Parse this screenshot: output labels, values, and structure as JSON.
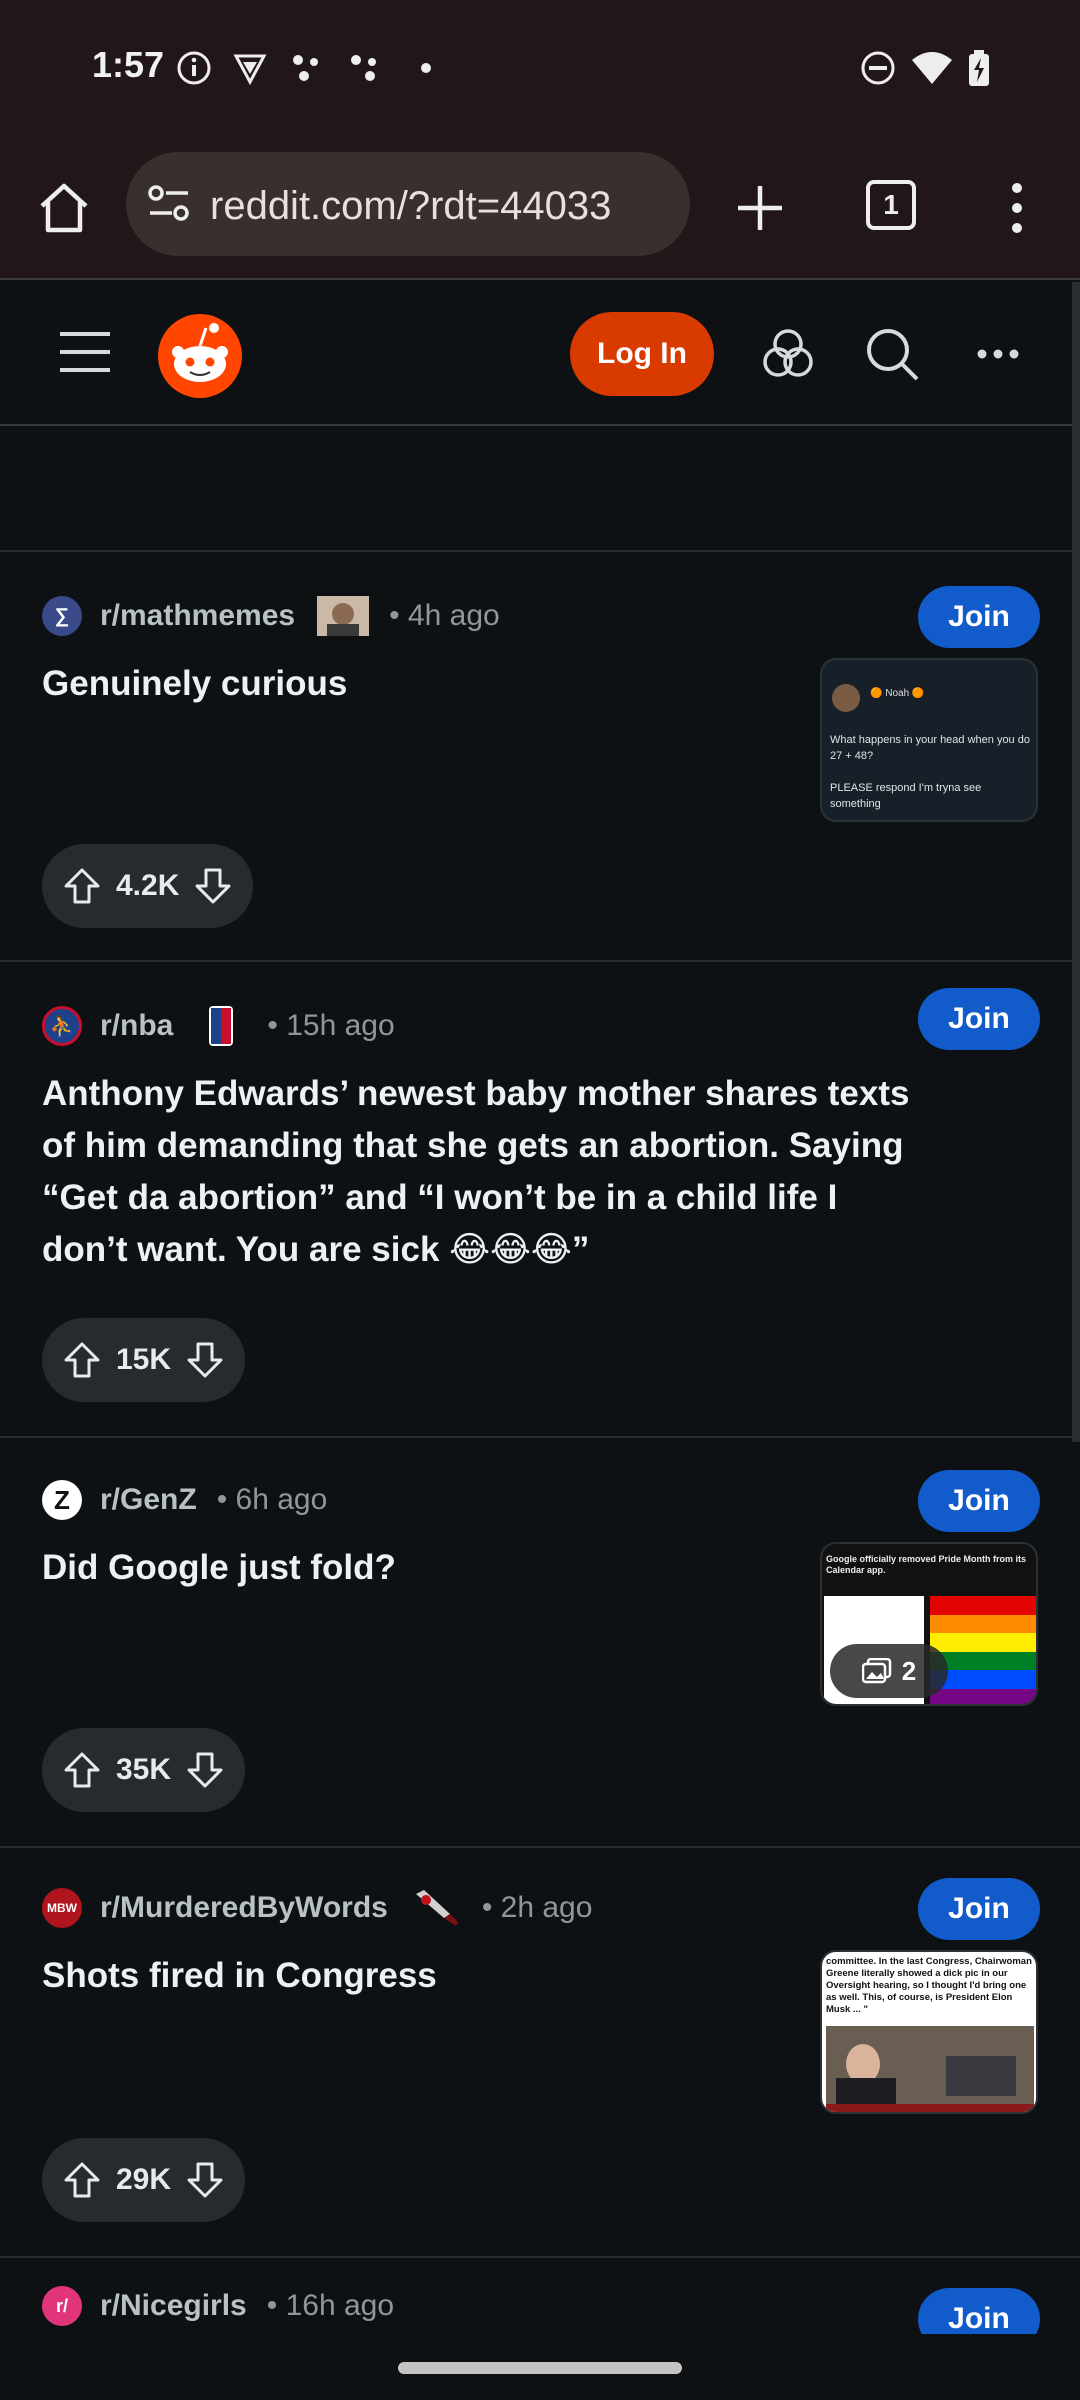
{
  "status_bar": {
    "time": "1:57"
  },
  "browser": {
    "url": "reddit.com/?rdt=44033",
    "tab_count": "1"
  },
  "header": {
    "login_label": "Log In"
  },
  "posts": [
    {
      "subreddit": "r/mathmemes",
      "time": "• 4h ago",
      "title": "Genuinely curious",
      "votes": "4.2K",
      "join_label": "Join",
      "thumb": {
        "line1": "🟠 Noah 🟠",
        "line2": "What happens in your head when you do 27 + 48?",
        "line3": "PLEASE respond I'm tryna see something"
      }
    },
    {
      "subreddit": "r/nba",
      "time": "• 15h ago",
      "title": "Anthony Edwards’ newest baby mother shares texts of him demanding that she gets an abortion. Saying “Get da abortion” and “I won’t be in a child life I don’t want. You are sick 😂😂😂”",
      "votes": "15K",
      "join_label": "Join"
    },
    {
      "subreddit": "r/GenZ",
      "time": "• 6h ago",
      "title": "Did Google just fold?",
      "votes": "35K",
      "join_label": "Join",
      "thumb": {
        "caption": "Google officially removed Pride Month from its Calendar app.",
        "gallery_count": "2"
      }
    },
    {
      "subreddit": "r/MurderedByWords",
      "time": "• 2h ago",
      "title": "Shots fired in Congress",
      "votes": "29K",
      "join_label": "Join",
      "thumb": {
        "caption": "committee. In the last Congress, Chairwoman Greene literally showed a dick pic in our Oversight hearing, so I thought I'd bring one as well. This, of course, is President Elon Musk ... \""
      }
    },
    {
      "subreddit": "r/Nicegirls",
      "time": "• 16h ago",
      "join_label": "Join"
    }
  ],
  "colors": {
    "accent_join": "#115bca",
    "login": "#d93a00",
    "background": "#0e1113"
  }
}
